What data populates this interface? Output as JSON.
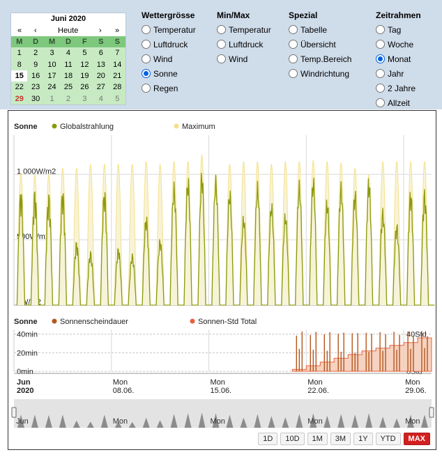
{
  "calendar": {
    "title": "Juni 2020",
    "nav": {
      "prev_year": "«",
      "prev_month": "‹",
      "today": "Heute",
      "next_month": "›",
      "next_year": "»"
    },
    "weekdays": [
      "M",
      "D",
      "M",
      "D",
      "F",
      "S",
      "S"
    ],
    "weeks": [
      [
        "1",
        "2",
        "3",
        "4",
        "5",
        "6",
        "7"
      ],
      [
        "8",
        "9",
        "10",
        "11",
        "12",
        "13",
        "14"
      ],
      [
        "15",
        "16",
        "17",
        "18",
        "19",
        "20",
        "21"
      ],
      [
        "22",
        "23",
        "24",
        "25",
        "26",
        "27",
        "28"
      ],
      [
        "29",
        "30",
        "1",
        "2",
        "3",
        "4",
        "5"
      ]
    ],
    "selected": "15",
    "today": "29"
  },
  "wettergroesse": {
    "title": "Wettergrösse",
    "options": [
      "Temperatur",
      "Luftdruck",
      "Wind",
      "Sonne",
      "Regen"
    ],
    "selected": "Sonne"
  },
  "minmax": {
    "title": "Min/Max",
    "options": [
      "Temperatur",
      "Luftdruck",
      "Wind"
    ],
    "selected": ""
  },
  "spezial": {
    "title": "Spezial",
    "options": [
      "Tabelle",
      "Übersicht",
      "Temp.Bereich",
      "Windrichtung"
    ],
    "selected": ""
  },
  "zeitrahmen": {
    "title": "Zeitrahmen",
    "options": [
      "Tag",
      "Woche",
      "Monat",
      "Jahr",
      "2 Jahre",
      "Allzeit"
    ],
    "selected": "Monat"
  },
  "colors": {
    "globalstrahlung": "#8a9a10",
    "maximum": "#f5e08a",
    "sonnenscheindauer": "#b5561c",
    "sonnen_std_total": "#e8603c",
    "selected_radio": "#0060df",
    "max_button": "#d22020"
  },
  "chart_data": [
    {
      "type": "line",
      "title": "Sonne",
      "series": [
        {
          "name": "Globalstrahlung",
          "daily_peak_w_m2": [
            900,
            900,
            870,
            900,
            500,
            420,
            900,
            450,
            400,
            700,
            520,
            950,
            1000,
            1040,
            1000,
            900,
            700,
            950,
            800,
            720,
            960,
            1000,
            830,
            950,
            900,
            1000,
            750,
            640,
            900,
            900
          ]
        },
        {
          "name": "Maximum",
          "daily_peak_w_m2": [
            1010,
            1000,
            1000,
            1050,
            1050,
            1080,
            1080,
            1080,
            1080,
            1100,
            1080,
            1100,
            1100,
            1150,
            1000,
            1080,
            1100,
            1100,
            1080,
            1100,
            1100,
            1110,
            1100,
            1090,
            1050,
            1000,
            1100,
            1100,
            1100,
            1100
          ]
        }
      ],
      "x": [
        "Jun 2020",
        "Mon 08.06.",
        "Mon 15.06.",
        "Mon 22.06.",
        "Mon 29.06."
      ],
      "yticks": [
        "0W/m2",
        "500W/m2",
        "1 000W/m2"
      ],
      "ylim": [
        0,
        1300
      ]
    },
    {
      "type": "line",
      "title": "Sonne",
      "series": [
        {
          "name": "Sonnenscheindauer",
          "values_min": [
            0,
            0,
            0,
            0,
            0,
            0,
            0,
            0,
            0,
            0,
            0,
            0,
            0,
            0,
            0,
            0,
            0,
            0,
            0,
            0,
            60,
            60,
            60,
            60,
            60,
            60,
            60,
            60,
            60,
            60
          ]
        },
        {
          "name": "Sonnen-Std Total",
          "values_std": [
            0,
            0,
            0,
            0,
            0,
            0,
            0,
            0,
            0,
            0,
            0,
            0,
            0,
            0,
            0,
            0,
            0,
            0,
            0,
            0,
            2,
            6,
            10,
            14,
            18,
            22,
            25,
            28,
            31,
            36
          ]
        }
      ],
      "left_yticks": [
        "0min",
        "20min",
        "40min"
      ],
      "right_yticks": [
        "0Std",
        "20Std",
        "40Std"
      ]
    }
  ],
  "xaxis": {
    "labels": [
      {
        "line1": "Jun",
        "line2": "2020"
      },
      {
        "line1": "Mon",
        "line2": "08.06."
      },
      {
        "line1": "Mon",
        "line2": "15.06."
      },
      {
        "line1": "Mon",
        "line2": "22.06."
      },
      {
        "line1": "Mon",
        "line2": "29.06."
      }
    ]
  },
  "navigator": {
    "labels": [
      "Jun",
      "Mon",
      "Mon",
      "Mon",
      "Mon"
    ]
  },
  "range_buttons": [
    "1D",
    "10D",
    "1M",
    "3M",
    "1Y",
    "YTD",
    "MAX"
  ],
  "range_selected": "MAX"
}
